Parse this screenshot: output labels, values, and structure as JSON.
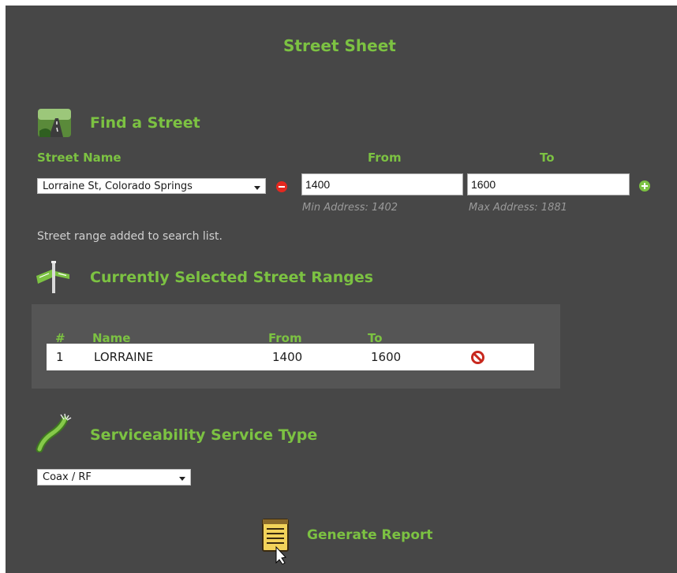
{
  "page": {
    "title": "Street Sheet"
  },
  "find_street": {
    "title": "Find a Street",
    "icon": "road-icon",
    "columns": {
      "street_name": "Street Name",
      "from": "From",
      "to": "To"
    },
    "street_select": {
      "value": "Lorraine St, Colorado Springs"
    },
    "from_input": {
      "value": "1400"
    },
    "to_input": {
      "value": "1600"
    },
    "min_address": "Min Address: 1402",
    "max_address": "Max Address: 1881",
    "status": "Street range added to search list."
  },
  "selected_ranges": {
    "title": "Currently Selected Street Ranges",
    "icon": "street-sign-icon",
    "headers": [
      "#",
      "Name",
      "From",
      "To"
    ],
    "rows": [
      {
        "num": "1",
        "name": "LORRAINE",
        "from": "1400",
        "to": "1600"
      }
    ]
  },
  "service_type": {
    "title": "Serviceability Service Type",
    "icon": "cable-icon",
    "select": {
      "value": "Coax / RF"
    }
  },
  "actions": {
    "generate_report": "Generate Report"
  },
  "colors": {
    "accent_green": "#7cc242",
    "panel_bg": "#474747",
    "remove_red": "#e4281f"
  }
}
